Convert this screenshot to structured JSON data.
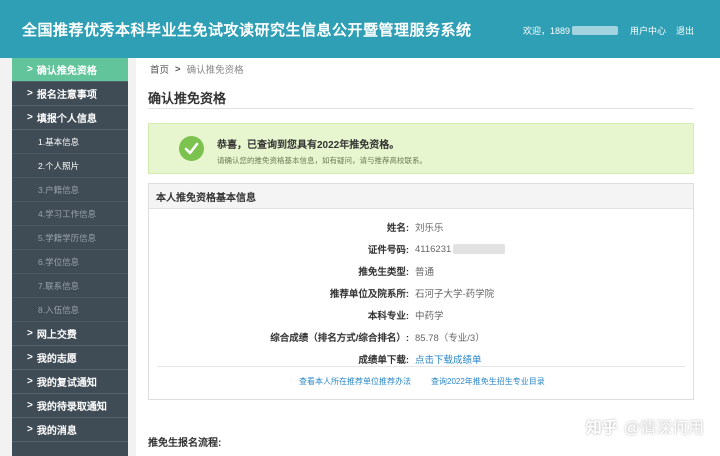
{
  "header": {
    "title": "全国推荐优秀本科毕业生免试攻读研究生信息公开暨管理服务系统",
    "welcome": "欢迎，1889",
    "user_center": "用户中心",
    "logout": "退出"
  },
  "sidebar": {
    "items": [
      {
        "label": "确认推免资格"
      },
      {
        "label": "报名注意事项"
      },
      {
        "label": "填报个人信息"
      }
    ],
    "sub_items": [
      {
        "label": "1.基本信息"
      },
      {
        "label": "2.个人照片"
      },
      {
        "label": "3.户籍信息"
      },
      {
        "label": "4.学习工作信息"
      },
      {
        "label": "5.学籍学历信息"
      },
      {
        "label": "6.学位信息"
      },
      {
        "label": "7.联系信息"
      },
      {
        "label": "8.入伍信息"
      }
    ],
    "items2": [
      {
        "label": "网上交费"
      },
      {
        "label": "我的志愿"
      },
      {
        "label": "我的复试通知"
      },
      {
        "label": "我的待录取通知"
      },
      {
        "label": "我的消息"
      }
    ]
  },
  "breadcrumb": {
    "home": "首页",
    "current": "确认推免资格"
  },
  "page_title": "确认推免资格",
  "notice": {
    "title": "恭喜，已查询到您具有2022年推免资格。",
    "subtitle": "请确认您的推免资格基本信息，如有疑问，请与推荐高校联系。"
  },
  "panel": {
    "title": "本人推免资格基本信息",
    "fields": [
      {
        "label": "姓名:",
        "value": "刘乐乐"
      },
      {
        "label": "证件号码:",
        "value": "4116231"
      },
      {
        "label": "推免生类型:",
        "value": "普通"
      },
      {
        "label": "推荐单位及院系所:",
        "value": "石河子大学-药学院"
      },
      {
        "label": "本科专业:",
        "value": "中药学"
      },
      {
        "label": "综合成绩（排名方式/综合排名）:",
        "value": "85.78（专业/3）"
      },
      {
        "label": "成绩单下载:",
        "value": "点击下载成绩单"
      }
    ],
    "link1": "查看本人所在推荐单位推荐办法",
    "link2": "查询2022年推免生招生专业目录"
  },
  "flow_title": "推免生报名流程:",
  "watermark": {
    "brand": "知乎",
    "author": "@情深何用"
  }
}
